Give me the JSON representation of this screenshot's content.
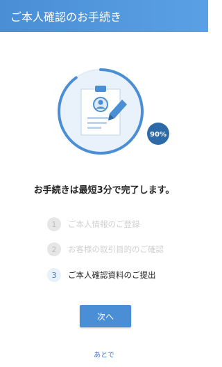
{
  "header": {
    "title": "ご本人確認のお手続き"
  },
  "progress": {
    "label": "90%",
    "percent": 90
  },
  "colors": {
    "accent": "#4a8fd6",
    "header": "#4a8fd6",
    "muted": "#d0d0d0"
  },
  "main": {
    "headline": "お手続きは最短3分で完了します。",
    "steps": [
      {
        "number": "1",
        "label": "ご本人情報のご登録",
        "state": "done"
      },
      {
        "number": "2",
        "label": "お客様の取引目的のご確認",
        "state": "done"
      },
      {
        "number": "3",
        "label": "ご本人確認資料のご提出",
        "state": "current"
      }
    ],
    "next_label": "次へ",
    "later_label": "あとで"
  },
  "icons": [
    "document-with-person-icon",
    "pen-icon",
    "progress-ring"
  ]
}
